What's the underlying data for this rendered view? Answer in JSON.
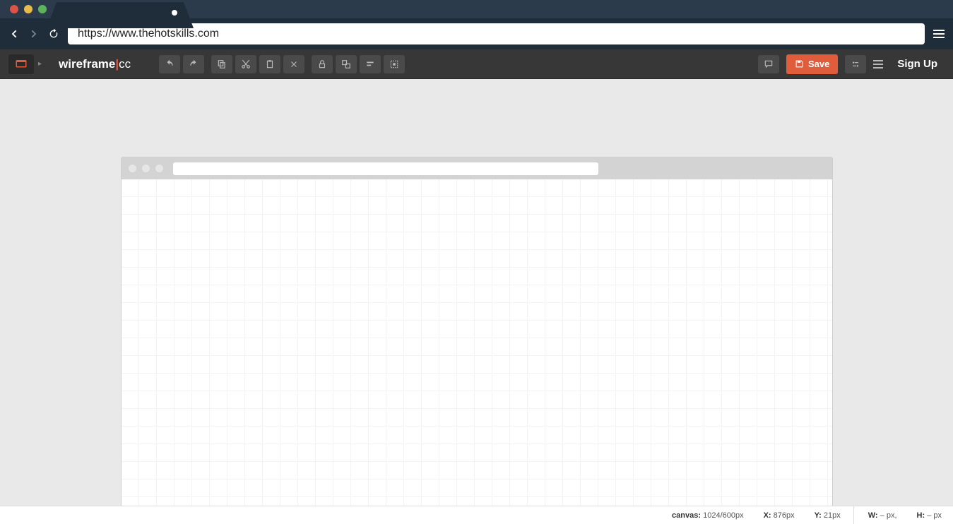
{
  "browser": {
    "url": "https://www.thehotskills.com"
  },
  "app": {
    "logo_a": "wireframe",
    "logo_sep": "|",
    "logo_b": "cc",
    "save_label": "Save",
    "signup_label": "Sign Up"
  },
  "status": {
    "canvas_label": "canvas:",
    "canvas_value": "1024/600px",
    "x_label": "X:",
    "x_value": "876px",
    "y_label": "Y:",
    "y_value": "21px",
    "w_label": "W:",
    "w_value": "– px,",
    "h_label": "H:",
    "h_value": "– px"
  }
}
